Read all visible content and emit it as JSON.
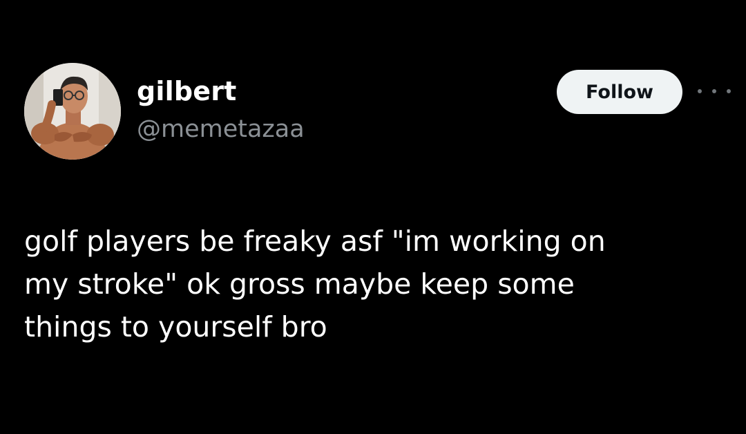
{
  "author": {
    "display_name": "gilbert",
    "handle": "@memetazaa"
  },
  "actions": {
    "follow_label": "Follow",
    "more_icon": "more-horizontal-icon"
  },
  "tweet": {
    "lines": [
      "golf players be freaky asf \"im working on",
      "my stroke\" ok gross maybe keep some",
      "things to yourself bro"
    ]
  },
  "colors": {
    "background": "#000000",
    "primary_text": "#ffffff",
    "secondary_text": "#8b9095",
    "follow_bg": "#eff3f4",
    "follow_text": "#0f1419"
  }
}
